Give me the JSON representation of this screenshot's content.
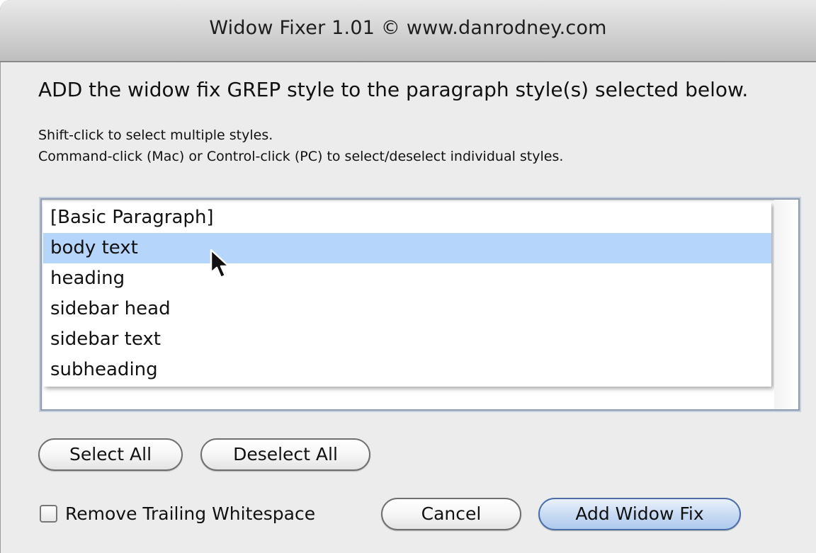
{
  "window": {
    "title": "Widow Fixer 1.01 © www.danrodney.com"
  },
  "heading": "ADD the widow fix GREP style to the paragraph style(s) selected below.",
  "instructions": {
    "line1": "Shift-click to select multiple styles.",
    "line2": "Command-click (Mac) or Control-click (PC) to select/deselect individual styles."
  },
  "styles_list": {
    "items": [
      {
        "label": "[Basic Paragraph]",
        "selected": false
      },
      {
        "label": "body text",
        "selected": true
      },
      {
        "label": "heading",
        "selected": false
      },
      {
        "label": "sidebar head",
        "selected": false
      },
      {
        "label": "sidebar text",
        "selected": false
      },
      {
        "label": "subheading",
        "selected": false
      }
    ]
  },
  "buttons": {
    "select_all": "Select All",
    "deselect_all": "Deselect All",
    "cancel": "Cancel",
    "add_widow_fix": "Add Widow Fix"
  },
  "checkbox": {
    "label": "Remove Trailing Whitespace",
    "checked": false
  },
  "colors": {
    "selection": "#b5d5fb",
    "default_button": "#aecaee"
  },
  "icons": {
    "pointer": "arrow-cursor-icon"
  }
}
